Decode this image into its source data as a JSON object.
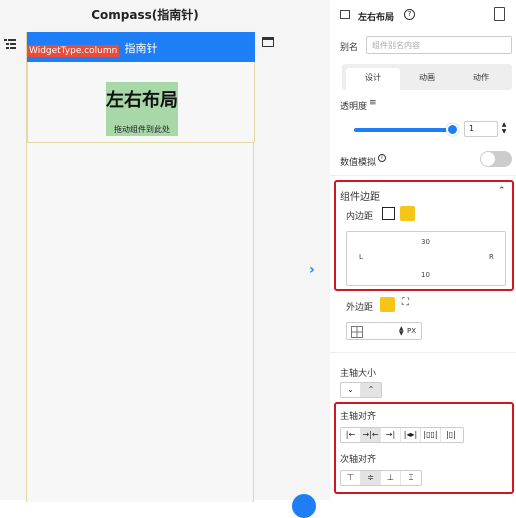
{
  "app": {
    "title": "Compass(指南针)"
  },
  "canvas": {
    "widget_tag": "WidgetType.column",
    "appbar_title": "指南针",
    "widget_title": "左右布局",
    "widget_hint": "拖动组件到此处"
  },
  "panel": {
    "title": "左右布局",
    "alias_label": "别名",
    "alias_placeholder": "组件别名内容",
    "tabs": [
      {
        "label": "设计",
        "active": true
      },
      {
        "label": "动画",
        "active": false
      },
      {
        "label": "动作",
        "active": false
      }
    ],
    "opacity_label": "透明度",
    "opacity_value": "1",
    "opacity_fraction": 1.0,
    "simulate_label": "数值模拟",
    "simulate_on": false,
    "spacing_section": "组件边距",
    "padding_label": "内边距",
    "padding": {
      "top": "30",
      "left": "L",
      "right": "R",
      "bottom": "10"
    },
    "margin_label": "外边距",
    "margin_unit": "PX",
    "main_size_label": "主轴大小",
    "main_align_label": "主轴对齐",
    "cross_align_label": "次轴对齐"
  },
  "colors": {
    "accent": "#1e7ef5",
    "highlight": "#d0161e",
    "widget_bg": "#a8d8a8",
    "tag_bg": "#e74c3c"
  }
}
